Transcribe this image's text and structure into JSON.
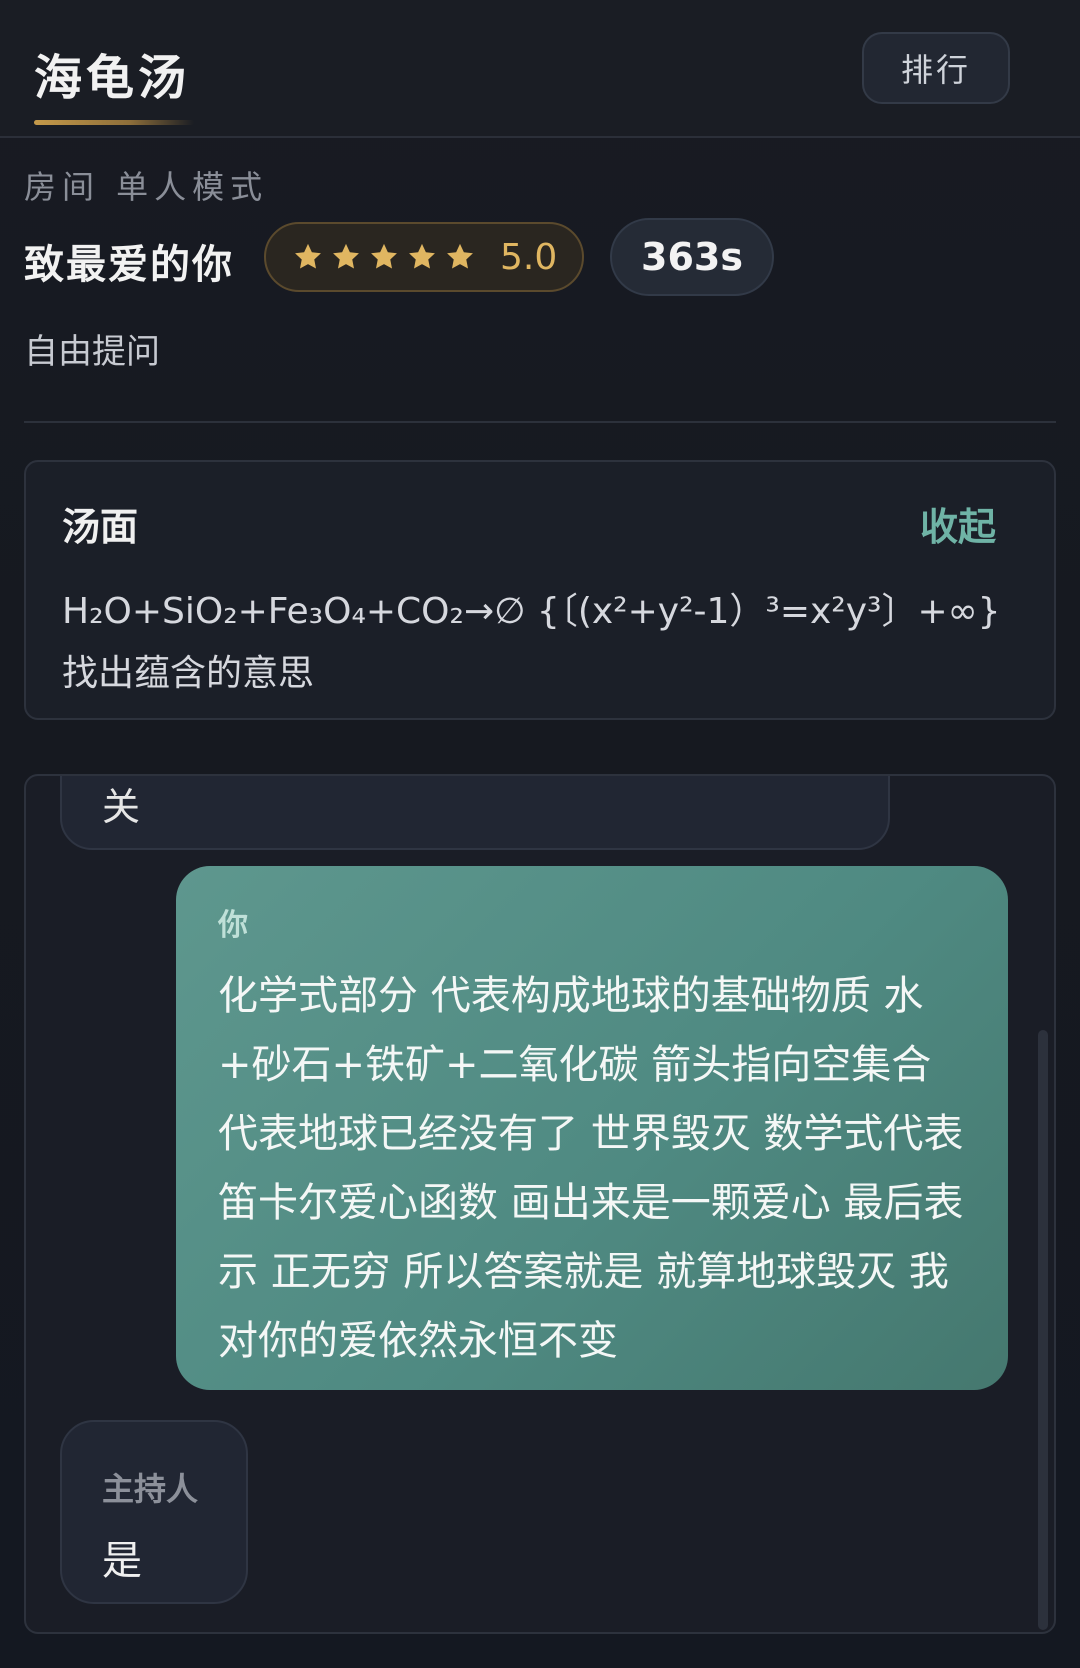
{
  "header": {
    "title": "海龟汤",
    "rank_label": "排行"
  },
  "room": {
    "room_line": "房间 单人模式",
    "puzzle_name": "致最爱的你",
    "rating": "5.0",
    "stars_filled": 5,
    "stars_total": 5,
    "timer": "363s",
    "mode": "自由提问"
  },
  "soup": {
    "label": "汤面",
    "collapse_label": "收起",
    "formula": "H₂O+SiO₂+Fe₃O₄+CO₂→∅ {〔(x²+y²-1）³=x²y³〕+∞}",
    "text": "找出蕴含的意思"
  },
  "chat": {
    "prev_partial_text": "关",
    "messages": [
      {
        "role": "user",
        "sender": "你",
        "text": "化学式部分 代表构成地球的基础物质 水+砂石+铁矿+二氧化碳 箭头指向空集合 代表地球已经没有了 世界毁灭 数学式代表笛卡尔爱心函数 画出来是一颗爱心 最后表示 正无穷 所以答案就是 就算地球毁灭 我对你的爱依然永恒不变"
      },
      {
        "role": "host",
        "sender": "主持人",
        "text": "是"
      }
    ]
  },
  "colors": {
    "accent_gold": "#e0b661",
    "accent_teal": "#6fb3a6",
    "user_bubble": "#5e978e"
  }
}
